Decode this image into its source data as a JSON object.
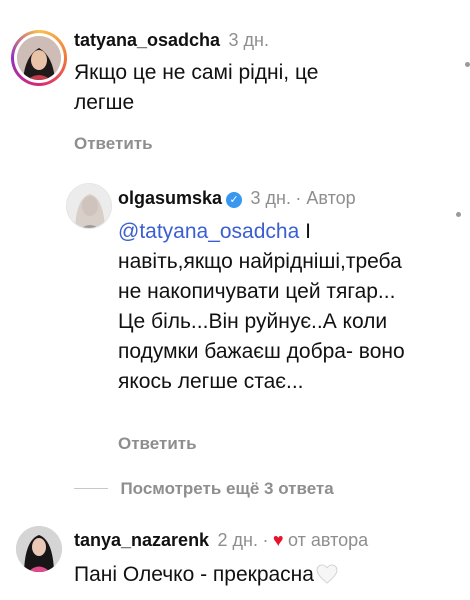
{
  "comments": [
    {
      "username": "tatyana_osadcha",
      "time": "3 дн.",
      "text": "Якщо це не самі рідні, це легше",
      "reply_label": "Ответить"
    },
    {
      "username": "olgasumska",
      "time": "3 дн.",
      "author_label": "· Автор",
      "mention": "@tatyana_osadcha",
      "text": " І навіть,якщо найрідніші,треба не накопичувати цей тягар... Це біль...Він руйнує..А коли подумки бажаєш добра- воно якось легше стає...",
      "reply_label": "Ответить"
    },
    {
      "username": "tanya_nazarenk",
      "time": "2 дн.",
      "separator": "·",
      "liked_by_author_label": "от автора",
      "text": "Пані Олечко - прекрасна"
    }
  ],
  "view_more_replies": "Посмотреть ещё 3 ответа",
  "colors": {
    "accent_link": "#3b5fd1",
    "secondary_text": "#8e8e8e",
    "verified_badge": "#3897f0",
    "heart": "#e8122d"
  }
}
